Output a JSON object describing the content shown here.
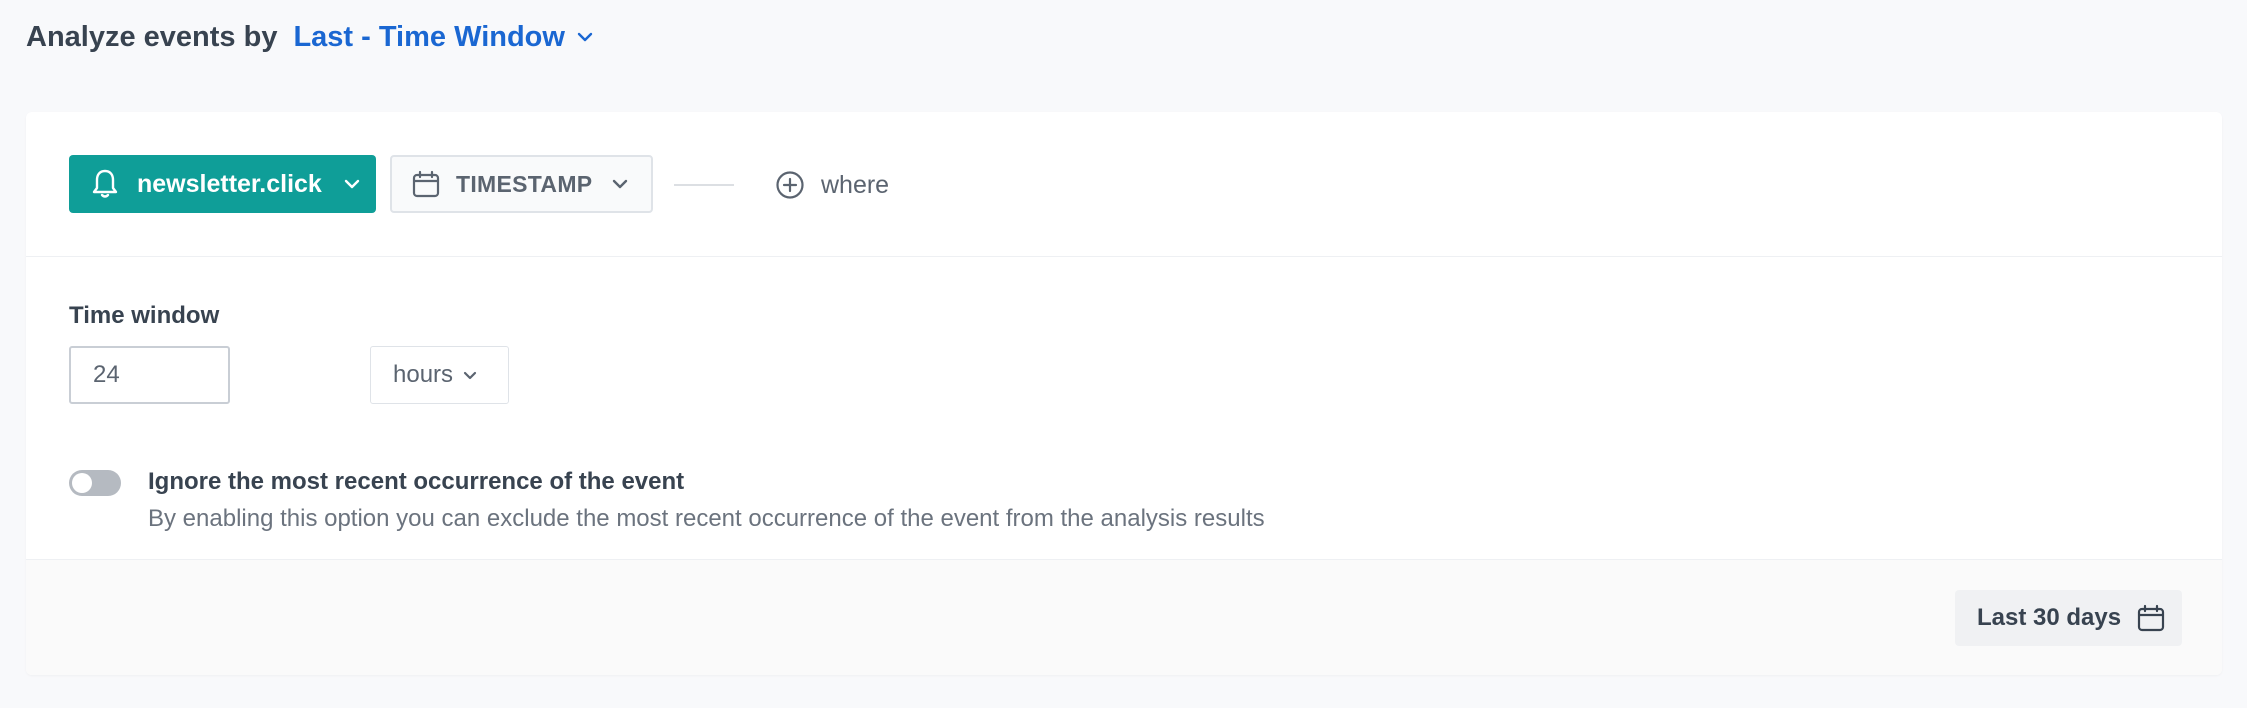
{
  "header": {
    "prefix": "Analyze events by",
    "mode": "Last - Time Window",
    "mode_icon": "chevron-down-icon",
    "accent_color": "#1a67d2"
  },
  "event_row": {
    "event_button": {
      "label": "newsletter.click",
      "icon": "bell-icon",
      "color": "#0f9e98"
    },
    "timestamp_button": {
      "label": "TIMESTAMP",
      "icon": "calendar-icon"
    },
    "where_button": {
      "label": "where",
      "icon": "plus-circle-icon"
    }
  },
  "time_window": {
    "label": "Time window",
    "value": "24",
    "unit": "hours"
  },
  "ignore_option": {
    "enabled": false,
    "title": "Ignore the most recent occurrence of the event",
    "description": "By enabling this option you can exclude the most recent occurrence of the event from the analysis results"
  },
  "footer": {
    "date_range_label": "Last 30 days",
    "date_range_icon": "calendar-icon"
  }
}
